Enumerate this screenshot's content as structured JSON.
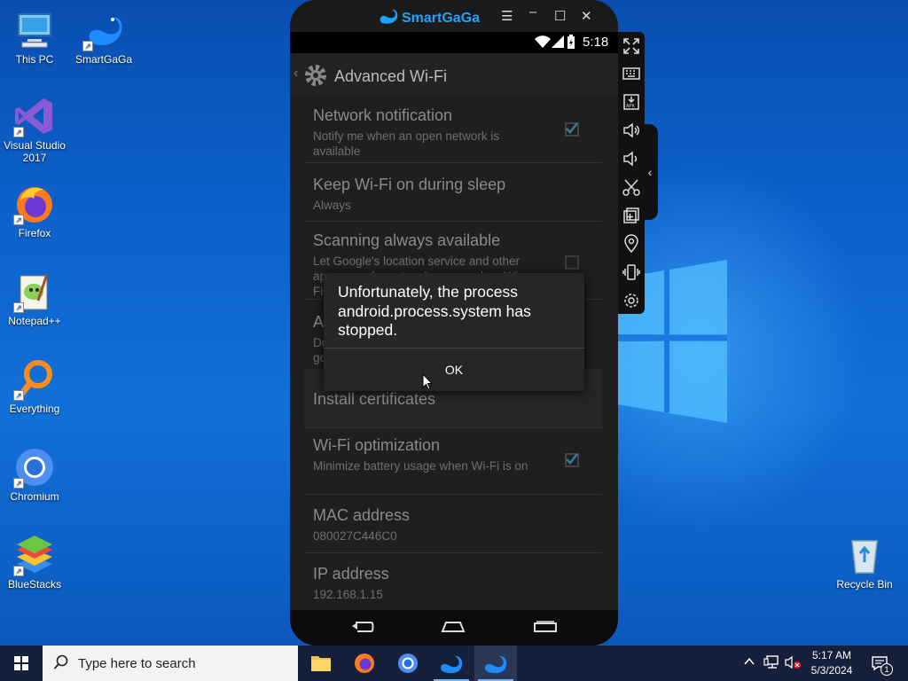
{
  "desktop": {
    "icons": [
      {
        "label": "This PC"
      },
      {
        "label": "SmartGaGa"
      },
      {
        "label": "Visual Studio 2017"
      },
      {
        "label": "Firefox"
      },
      {
        "label": "Notepad++"
      },
      {
        "label": "Everything"
      },
      {
        "label": "Chromium"
      },
      {
        "label": "BlueStacks"
      },
      {
        "label": "Recycle Bin"
      }
    ]
  },
  "emulator": {
    "title": "SmartGaGa",
    "status_time": "5:18",
    "settings_screen": {
      "title": "Advanced Wi-Fi",
      "preferences": [
        {
          "title": "Network notification",
          "summary": "Notify me when an open network is available",
          "checked": true
        },
        {
          "title": "Keep Wi-Fi on during sleep",
          "summary": "Always"
        },
        {
          "title": "Scanning always available",
          "summary": "Let Google's location service and other apps scan for networks, even when Wi-Fi is off",
          "summary_visible": "Let Google's location service and other",
          "summary_line2": "apps scan for networks, even when Wi-",
          "summary_line3": "Fi",
          "checked": false
        },
        {
          "title": "A",
          "summary_line1": "Do",
          "summary_line2": "go"
        },
        {
          "title": "Install certificates"
        },
        {
          "title": "Wi-Fi optimization",
          "summary": "Minimize battery usage when Wi-Fi is on",
          "checked": true
        },
        {
          "title": "MAC address",
          "summary": "080027C446C0"
        },
        {
          "title": "IP address",
          "summary": "192.168.1.15"
        }
      ]
    },
    "dialog": {
      "message": "Unfortunately, the process android.process.system has stopped.",
      "ok_label": "OK"
    }
  },
  "taskbar": {
    "search_placeholder": "Type here to search",
    "time": "5:17 AM",
    "date": "5/3/2024",
    "notification_count": "1"
  },
  "colors": {
    "accent": "#1ea2ff",
    "taskbar": "#16203a"
  }
}
